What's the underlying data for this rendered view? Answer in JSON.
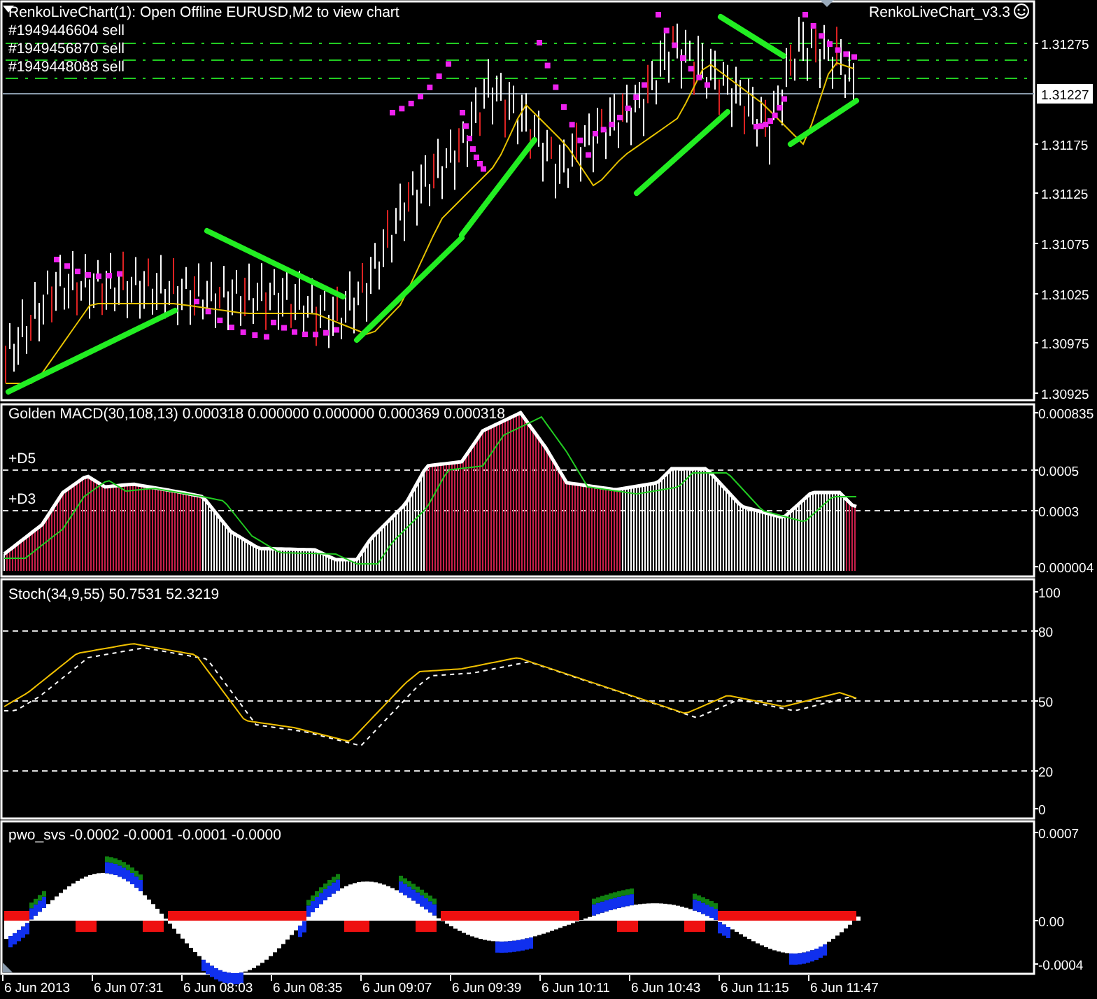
{
  "main_chart": {
    "title": "RenkoLiveChart(1): Open Offline EURUSD,M2 to view chart",
    "version_label": "RenkoLiveChart_v3.3",
    "orders": [
      "#1949446604 sell",
      "#1949456870 sell",
      "#1949448088 sell"
    ],
    "current_price": "1.31227",
    "price_axis": [
      "1.31275",
      "1.31175",
      "1.31125",
      "1.31075",
      "1.31025",
      "1.30975",
      "1.30925"
    ]
  },
  "macd_pane": {
    "title": "Golden MACD(30,108,13) 0.000318 0.000000 0.000000 0.000369 0.000318",
    "levels": [
      "+D5",
      "+D3"
    ],
    "axis": [
      "0.000835",
      "0.0005",
      "0.0003",
      "0.000004"
    ]
  },
  "stoch_pane": {
    "title": "Stoch(34,9,55) 50.7531 52.3219",
    "axis": [
      "100",
      "80",
      "50",
      "20",
      "0"
    ]
  },
  "pwo_pane": {
    "title": "pwo_svs -0.0002 -0.0001 -0.0001 -0.0000",
    "axis": [
      "0.0007",
      "0.00",
      "-0.0004"
    ]
  },
  "time_axis": [
    "6 Jun 2013",
    "6 Jun 07:31",
    "6 Jun 08:03",
    "6 Jun 08:35",
    "6 Jun 09:07",
    "6 Jun 09:39",
    "6 Jun 10:11",
    "6 Jun 10:43",
    "6 Jun 11:15",
    "6 Jun 11:47"
  ]
}
